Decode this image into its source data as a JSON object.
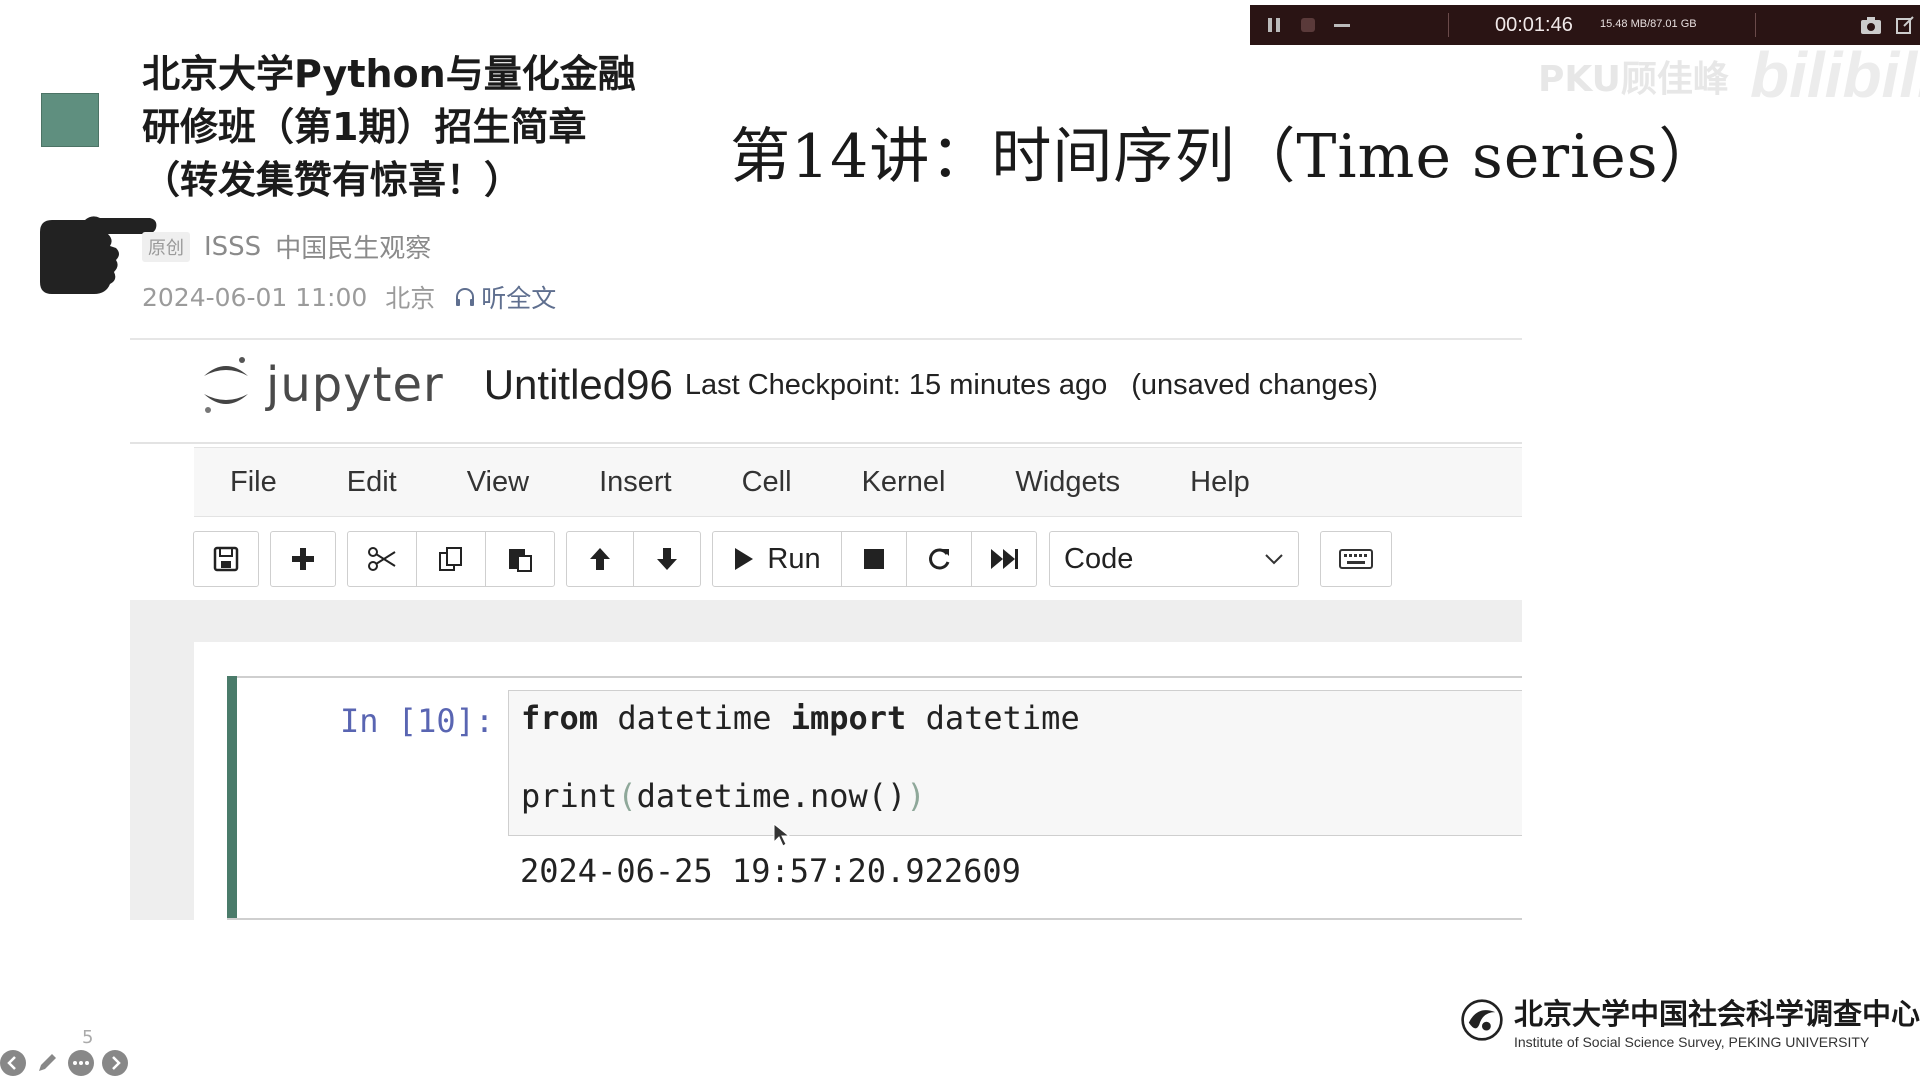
{
  "article": {
    "title_lines": [
      "北京大学Python与量化金融",
      "研修班（第1期）招生简章",
      "（转发集赞有惊喜！）"
    ],
    "badge": "原创",
    "authors": [
      "ISSS",
      "中国民生观察"
    ],
    "date": "2024-06-01 11:00",
    "location": "北京",
    "listen": "听全文"
  },
  "lecture_title": "第14讲：时间序列（Time series）",
  "recorder": {
    "elapsed": "00:01:46",
    "storage": "15.48 MB/87.01 GB",
    "watermark": "PKU顾佳峰",
    "brand": "bilibili"
  },
  "jupyter": {
    "logo_text": "jupyter",
    "notebook_name": "Untitled96",
    "checkpoint": "Last Checkpoint: 15 minutes ago",
    "status": "(unsaved changes)",
    "menu": [
      "File",
      "Edit",
      "View",
      "Insert",
      "Cell",
      "Kernel",
      "Widgets",
      "Help"
    ],
    "toolbar": {
      "run_label": "Run",
      "cell_type": "Code",
      "icons": [
        "save-icon",
        "plus-icon",
        "scissors-icon",
        "copy-icon",
        "paste-icon",
        "arrow-up-icon",
        "arrow-down-icon",
        "play-icon",
        "stop-icon",
        "restart-icon",
        "fast-forward-icon",
        "keyboard-icon"
      ]
    },
    "cell": {
      "prompt": "In [10]:",
      "code_line1": {
        "kw1": "from",
        "mod": " datetime ",
        "kw2": "import",
        "name": " datetime"
      },
      "code_line2": {
        "fn": "print",
        "open": "(",
        "call": "datetime.now()",
        "close": ")"
      },
      "output": "2024-06-25 19:57:20.922609"
    }
  },
  "footer": {
    "org_cn": "北京大学中国社会科学调查中心",
    "org_en": "Institute of Social Science Survey, PEKING UNIVERSITY",
    "page_number": "5"
  },
  "colors": {
    "cell_border": "#4a7b6a",
    "record_bar": "#2a1414",
    "prompt": "#303f9f"
  }
}
